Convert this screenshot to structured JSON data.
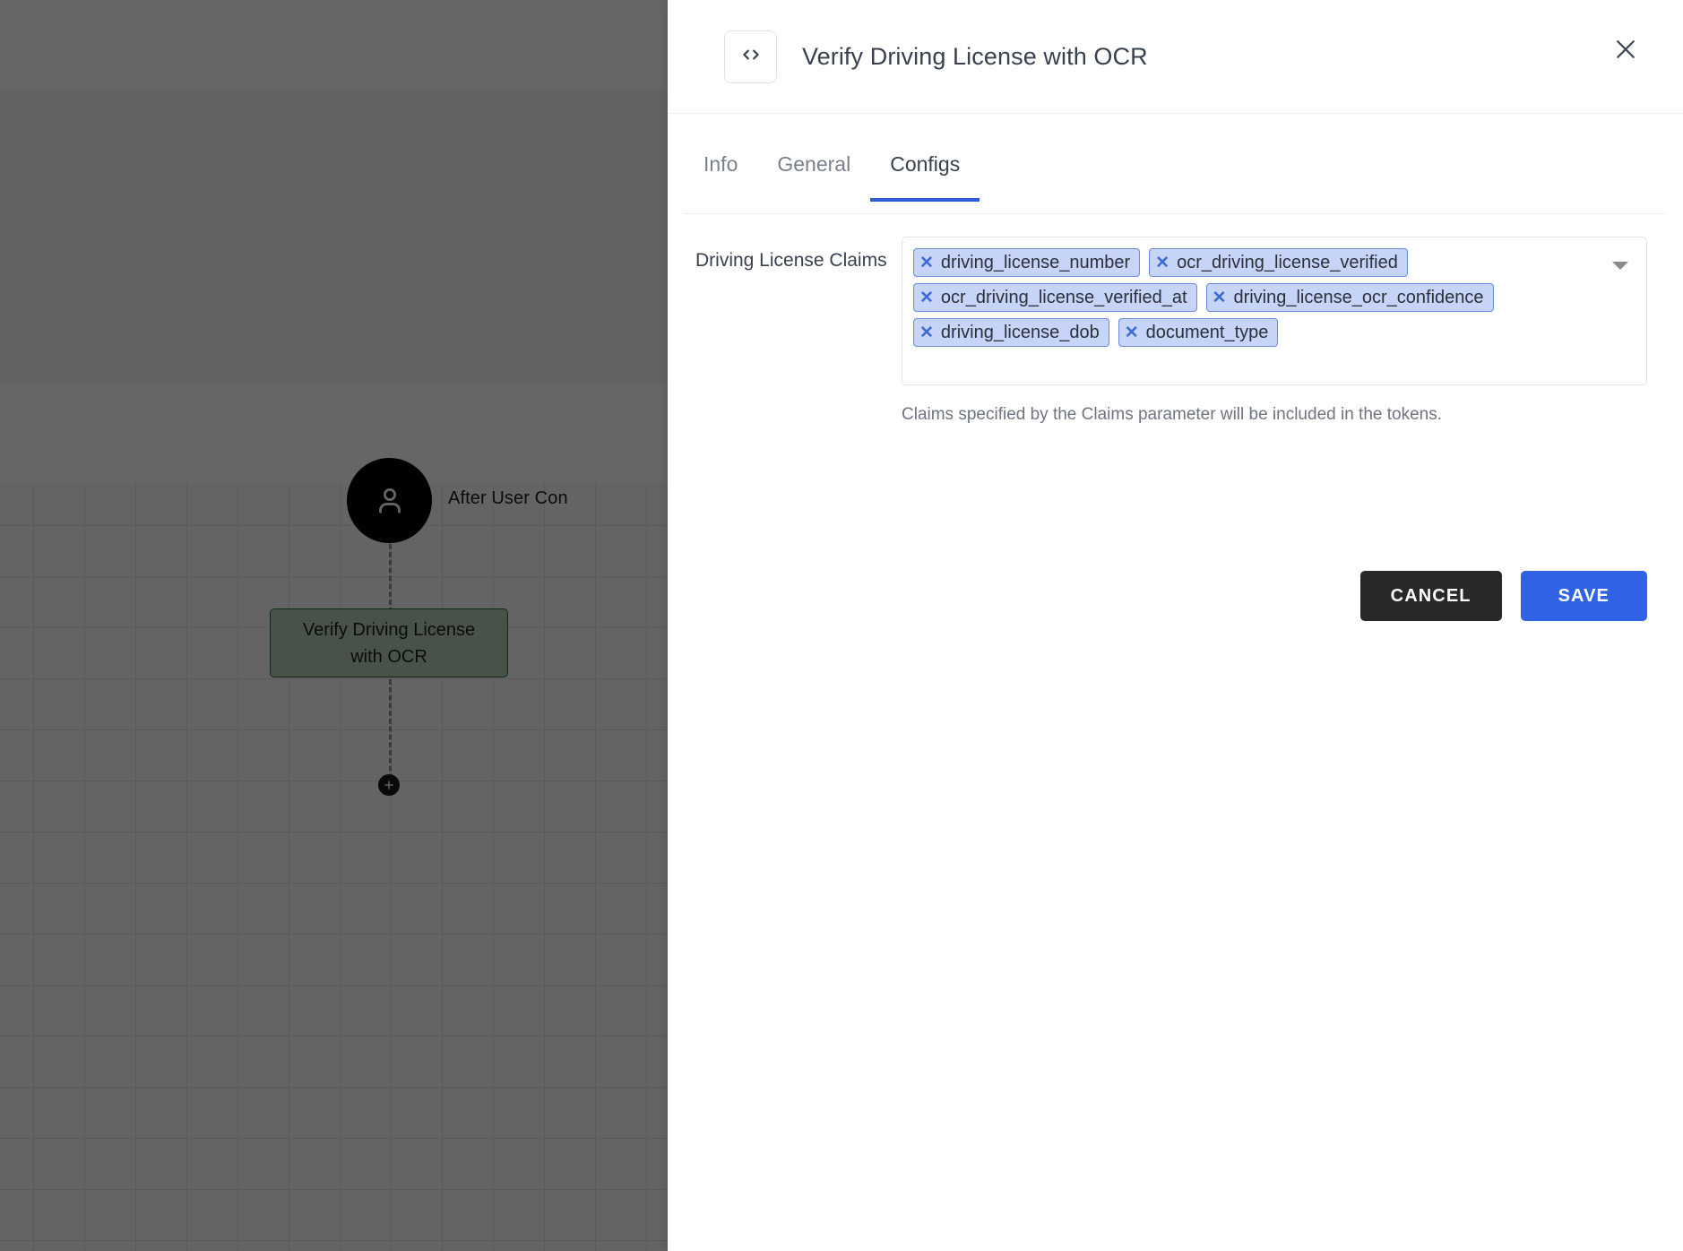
{
  "canvas": {
    "user_node": {
      "icon": "user-icon",
      "caption": "After User Con"
    },
    "action_node": {
      "label": "Verify Driving License with OCR"
    },
    "add_node_button": {
      "icon": "plus-icon"
    }
  },
  "modal": {
    "header": {
      "icon": "code-brackets-icon",
      "title": "Verify Driving License with OCR",
      "close_icon": "close-icon"
    },
    "tabs": [
      {
        "label": "Info",
        "active": false
      },
      {
        "label": "General",
        "active": false
      },
      {
        "label": "Configs",
        "active": true
      }
    ],
    "form": {
      "field_label": "Driving License Claims",
      "chips": [
        "driving_license_number",
        "ocr_driving_license_verified",
        "ocr_driving_license_verified_at",
        "driving_license_ocr_confidence",
        "driving_license_dob",
        "document_type"
      ],
      "dropdown_icon": "chevron-down-icon",
      "helper_text": "Claims specified by the Claims parameter will be included in the tokens."
    },
    "actions": {
      "cancel_label": "CANCEL",
      "save_label": "SAVE"
    }
  },
  "colors": {
    "accent_blue": "#2f62e5",
    "tab_indicator": "#2d5bd7",
    "chip_bg": "#c6d4f7",
    "chip_border": "#6b8ae0",
    "chip_x": "#3d6bd6",
    "cancel_bg": "#282828",
    "node_green_bg": "#b7ceb4",
    "node_green_border": "#2f6b35",
    "user_node_bg": "#000000"
  }
}
